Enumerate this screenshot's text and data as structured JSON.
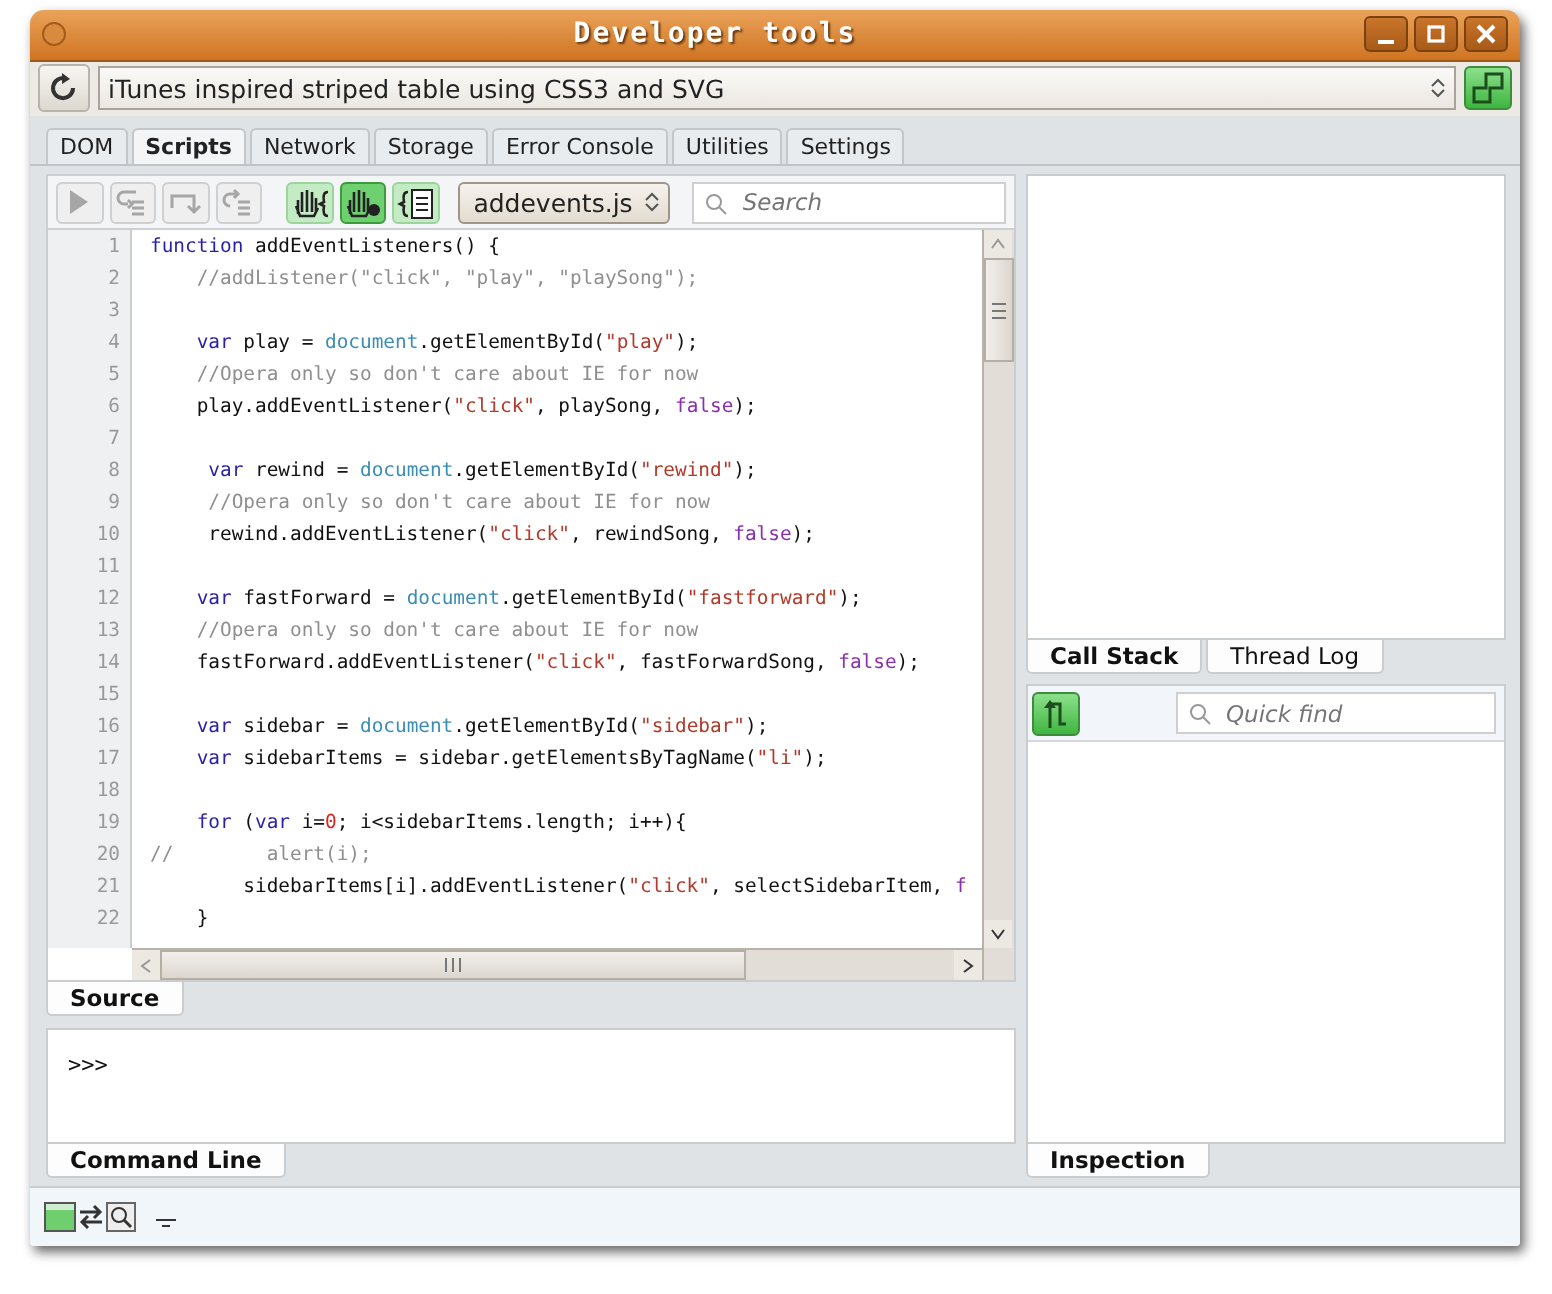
{
  "window": {
    "title": "Developer tools"
  },
  "address_bar": {
    "value": "iTunes inspired striped table using CSS3 and SVG"
  },
  "tabs": [
    {
      "label": "DOM",
      "selected": false
    },
    {
      "label": "Scripts",
      "selected": true
    },
    {
      "label": "Network",
      "selected": false
    },
    {
      "label": "Storage",
      "selected": false
    },
    {
      "label": "Error Console",
      "selected": false
    },
    {
      "label": "Utilities",
      "selected": false
    },
    {
      "label": "Settings",
      "selected": false
    }
  ],
  "debug_buttons": [
    {
      "kind": "continue",
      "disabled": true
    },
    {
      "kind": "step-into",
      "disabled": true
    },
    {
      "kind": "step-over",
      "disabled": true
    },
    {
      "kind": "step-out",
      "disabled": true
    }
  ],
  "toggles": [
    {
      "kind": "hand-brace",
      "selected": false
    },
    {
      "kind": "hand-stop",
      "selected": true
    },
    {
      "kind": "log",
      "selected": false
    }
  ],
  "script_select": {
    "value": "addevents.js"
  },
  "search": {
    "placeholder": "Search"
  },
  "source": {
    "lines": [
      {
        "number": "1",
        "tokens": [
          {
            "kind": "keyword",
            "text": "function"
          },
          {
            "kind": "plain",
            "text": " addEventListeners() {"
          }
        ]
      },
      {
        "number": "2",
        "tokens": [
          {
            "kind": "comment",
            "text": "    //addListener(\"click\", \"play\", \"playSong\");"
          }
        ]
      },
      {
        "number": "3"
      },
      {
        "number": "4",
        "tokens": [
          {
            "kind": "keyword",
            "text": "    var"
          },
          {
            "kind": "plain",
            "text": " play = "
          },
          {
            "kind": "object",
            "text": "document"
          },
          {
            "kind": "plain",
            "text": ".getElementById("
          },
          {
            "kind": "string",
            "text": "\"play\""
          },
          {
            "kind": "plain",
            "text": ");"
          }
        ]
      },
      {
        "number": "5",
        "tokens": [
          {
            "kind": "comment",
            "text": "    //Opera only so don't care about IE for now"
          }
        ]
      },
      {
        "number": "6",
        "tokens": [
          {
            "kind": "plain",
            "text": "    play.addEventListener("
          },
          {
            "kind": "string",
            "text": "\"click\""
          },
          {
            "kind": "plain",
            "text": ", playSong, "
          },
          {
            "kind": "boolean",
            "text": "false"
          },
          {
            "kind": "plain",
            "text": ");"
          }
        ]
      },
      {
        "number": "7"
      },
      {
        "number": "8",
        "tokens": [
          {
            "kind": "keyword",
            "text": "     var"
          },
          {
            "kind": "plain",
            "text": " rewind = "
          },
          {
            "kind": "object",
            "text": "document"
          },
          {
            "kind": "plain",
            "text": ".getElementById("
          },
          {
            "kind": "string",
            "text": "\"rewind\""
          },
          {
            "kind": "plain",
            "text": ");"
          }
        ]
      },
      {
        "number": "9",
        "tokens": [
          {
            "kind": "comment",
            "text": "     //Opera only so don't care about IE for now"
          }
        ]
      },
      {
        "number": "10",
        "tokens": [
          {
            "kind": "plain",
            "text": "     rewind.addEventListener("
          },
          {
            "kind": "string",
            "text": "\"click\""
          },
          {
            "kind": "plain",
            "text": ", rewindSong, "
          },
          {
            "kind": "boolean",
            "text": "false"
          },
          {
            "kind": "plain",
            "text": ");"
          }
        ]
      },
      {
        "number": "11"
      },
      {
        "number": "12",
        "tokens": [
          {
            "kind": "keyword",
            "text": "    var"
          },
          {
            "kind": "plain",
            "text": " fastForward = "
          },
          {
            "kind": "object",
            "text": "document"
          },
          {
            "kind": "plain",
            "text": ".getElementById("
          },
          {
            "kind": "string",
            "text": "\"fastforward\""
          },
          {
            "kind": "plain",
            "text": ");"
          }
        ]
      },
      {
        "number": "13",
        "tokens": [
          {
            "kind": "comment",
            "text": "    //Opera only so don't care about IE for now"
          }
        ]
      },
      {
        "number": "14",
        "tokens": [
          {
            "kind": "plain",
            "text": "    fastForward.addEventListener("
          },
          {
            "kind": "string",
            "text": "\"click\""
          },
          {
            "kind": "plain",
            "text": ", fastForwardSong, "
          },
          {
            "kind": "boolean",
            "text": "false"
          },
          {
            "kind": "plain",
            "text": ");"
          }
        ]
      },
      {
        "number": "15"
      },
      {
        "number": "16",
        "tokens": [
          {
            "kind": "keyword",
            "text": "    var"
          },
          {
            "kind": "plain",
            "text": " sidebar = "
          },
          {
            "kind": "object",
            "text": "document"
          },
          {
            "kind": "plain",
            "text": ".getElementById("
          },
          {
            "kind": "string",
            "text": "\"sidebar\""
          },
          {
            "kind": "plain",
            "text": ");"
          }
        ]
      },
      {
        "number": "17",
        "tokens": [
          {
            "kind": "keyword",
            "text": "    var"
          },
          {
            "kind": "plain",
            "text": " sidebarItems = sidebar.getElementsByTagName("
          },
          {
            "kind": "string",
            "text": "\"li\""
          },
          {
            "kind": "plain",
            "text": ");"
          }
        ]
      },
      {
        "number": "18"
      },
      {
        "number": "19",
        "tokens": [
          {
            "kind": "keyword",
            "text": "    for"
          },
          {
            "kind": "plain",
            "text": " ("
          },
          {
            "kind": "keyword",
            "text": "var"
          },
          {
            "kind": "plain",
            "text": " i="
          },
          {
            "kind": "number",
            "text": "0"
          },
          {
            "kind": "plain",
            "text": "; i<sidebarItems.length; i++){"
          }
        ]
      },
      {
        "number": "20",
        "tokens": [
          {
            "kind": "comment",
            "text": "//        alert(i);"
          }
        ]
      },
      {
        "number": "21",
        "tokens": [
          {
            "kind": "plain",
            "text": "        sidebarItems[i].addEventListener("
          },
          {
            "kind": "string",
            "text": "\"click\""
          },
          {
            "kind": "plain",
            "text": ", selectSidebarItem, "
          },
          {
            "kind": "boolean",
            "text": "f"
          }
        ]
      },
      {
        "number": "22",
        "tokens": [
          {
            "kind": "plain",
            "text": "    }"
          }
        ]
      }
    ]
  },
  "source_tab": {
    "label": "Source"
  },
  "command_line": {
    "prompt": ">>>",
    "tab": "Command Line"
  },
  "side_tabs": [
    {
      "label": "Call Stack",
      "selected": true
    },
    {
      "label": "Thread Log",
      "selected": false
    }
  ],
  "quick_find": {
    "placeholder": "Quick find"
  },
  "inspection_tab": {
    "label": "Inspection"
  }
}
